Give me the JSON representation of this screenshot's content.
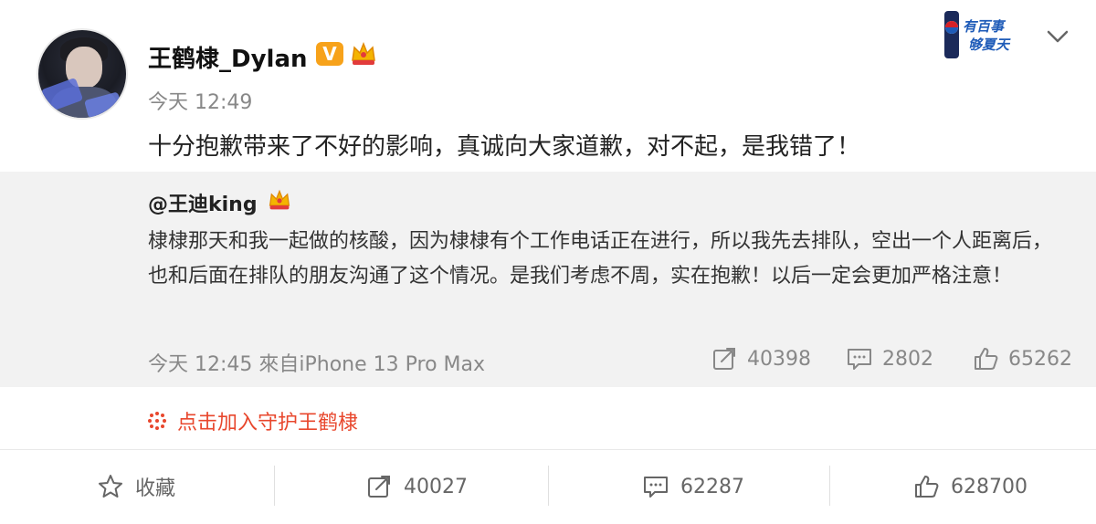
{
  "post": {
    "username": "王鹤棣_Dylan",
    "verified_badge": "V",
    "time": "今天 12:49",
    "text": "十分抱歉带来了不好的影响，真诚向大家道歉，对不起，是我错了！"
  },
  "retweet": {
    "user": "@王迪king",
    "text": "棣棣那天和我一起做的核酸，因为棣棣有个工作电话正在进行，所以我先去排队，空出一个人距离后，也和后面在排队的朋友沟通了这个情况。是我们考虑不周，实在抱歉！以后一定会更加严格注意！",
    "meta": "今天 12:45 來自iPhone 13 Pro Max",
    "reposts": "40398",
    "comments": "2802",
    "likes": "65262"
  },
  "guard_link": "点击加入守护王鹤棣",
  "actions": {
    "favorite": "收藏",
    "reposts": "40027",
    "comments": "62287",
    "likes": "628700"
  },
  "icons": {
    "favorite": "star-icon",
    "repost": "share-icon",
    "comment": "comment-icon",
    "like": "thumbs-up-icon",
    "guard": "sparkle-icon",
    "menu": "chevron-down-icon"
  },
  "colors": {
    "accent_orange": "#f7a21a",
    "link_red": "#e8472d",
    "retweet_bg": "#f2f2f2"
  }
}
